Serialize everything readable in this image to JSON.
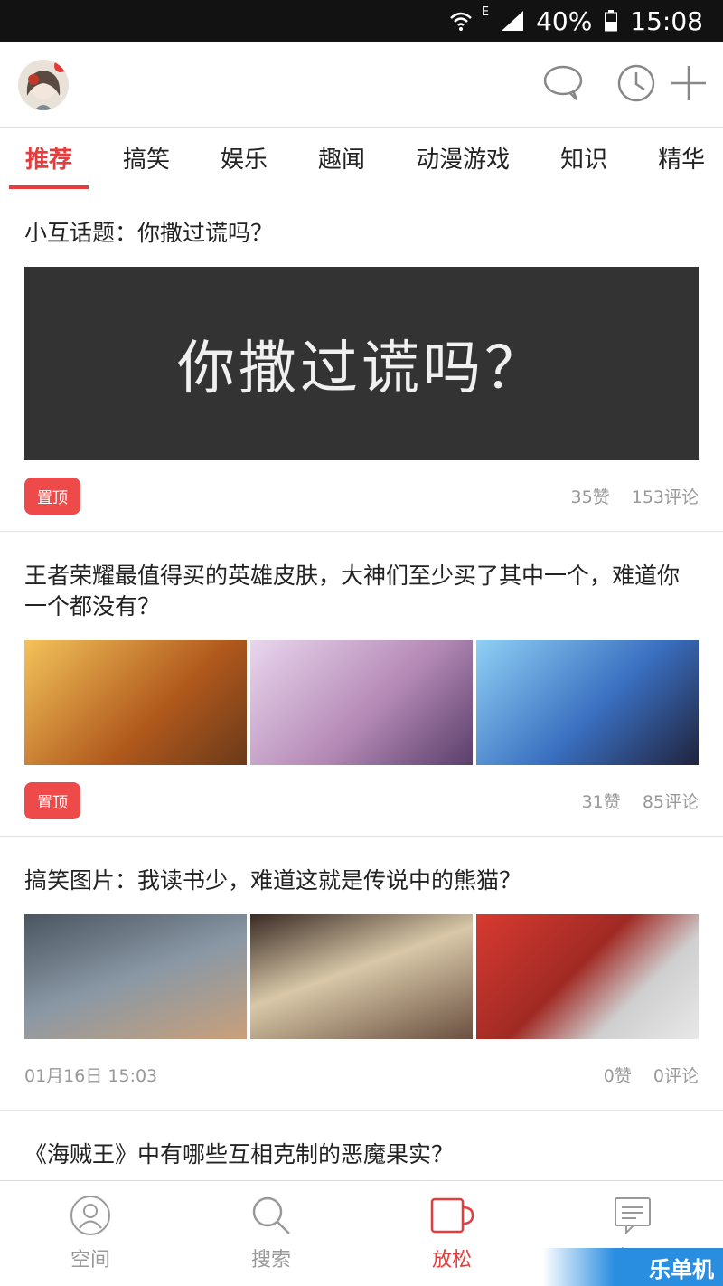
{
  "status_bar": {
    "network": "E",
    "battery": "40%",
    "time": "15:08"
  },
  "tabs": [
    "推荐",
    "搞笑",
    "娱乐",
    "趣闻",
    "动漫游戏",
    "知识",
    "精华"
  ],
  "feed": [
    {
      "title": "小互话题：你撒过谎吗？",
      "image_text": "你撒过谎吗？",
      "pin": "置顶",
      "likes": "35赞",
      "comments": "153评论"
    },
    {
      "title": "王者荣耀最值得买的英雄皮肤，大神们至少买了其中一个，难道你一个都没有？",
      "pin": "置顶",
      "likes": "31赞",
      "comments": "85评论",
      "colors": [
        "#d9a23a",
        "#b58ab6",
        "#3a6fc0"
      ]
    },
    {
      "title": "搞笑图片：我读书少，难道这就是传说中的熊猫？",
      "date": "01月16日 15:03",
      "likes": "0赞",
      "comments": "0评论",
      "colors": [
        "#6c7a8a",
        "#8a6b5a",
        "#c23b34"
      ]
    },
    {
      "title": "《海贼王》中有哪些互相克制的恶魔果实？"
    }
  ],
  "bottom_nav": [
    "空间",
    "搜索",
    "放松",
    "意见"
  ],
  "watermark": "乐单机"
}
